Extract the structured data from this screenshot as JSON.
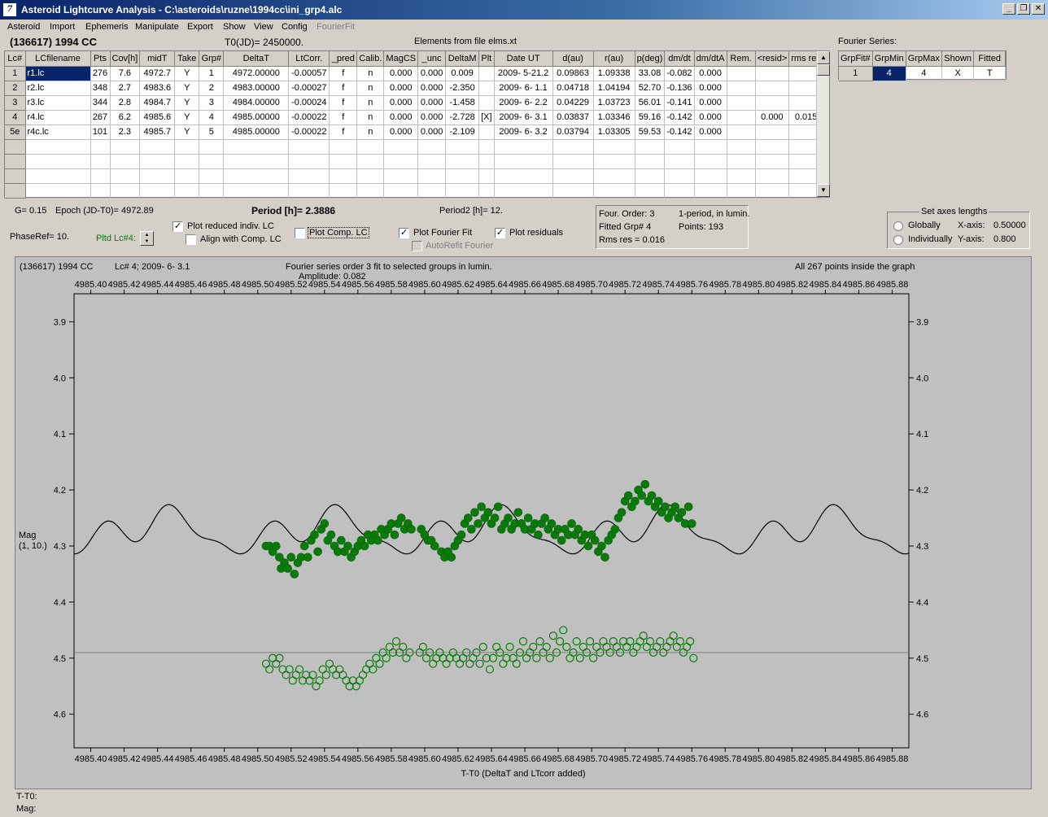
{
  "window": {
    "title": "Asteroid Lightcurve Analysis - C:\\asteroids\\ruzne\\1994cc\\ini_grp4.alc",
    "icon_name": "app-icon",
    "buttons": [
      "_",
      "❐",
      "✕"
    ]
  },
  "menu": [
    "Asteroid",
    "Import",
    "Ephemeris",
    "Manipulate",
    "Export",
    "Show",
    "View",
    "Config",
    "FourierFit"
  ],
  "header": {
    "asteroid": "(136617) 1994 CC",
    "t0": "T0(JD)= 2450000.",
    "elements": "Elements from file elms.xt",
    "fourier_label": "Fourier Series:"
  },
  "table": {
    "columns": [
      "Lc#",
      "LCfilename",
      "Pts",
      "Cov[h]",
      "midT",
      "Take",
      "Grp#",
      "DeltaT",
      "LtCorr.",
      "_pred",
      "Calib.",
      "MagCS",
      "_unc",
      "DeltaM",
      "Plt",
      "Date UT",
      "d(au)",
      "r(au)",
      "p(deg)",
      "dm/dt",
      "dm/dtA",
      "Rem.",
      "<resid>",
      "rms res"
    ],
    "rows": [
      [
        "1",
        "r1.lc",
        "276",
        "7.6",
        "4972.7",
        "Y",
        "1",
        "4972.00000",
        "-0.00057",
        "f",
        "n",
        "0.000",
        "0.000",
        "0.009",
        "",
        "2009- 5-21.2",
        "0.09863",
        "1.09338",
        "33.08",
        "-0.082",
        "0.000",
        "",
        "",
        ""
      ],
      [
        "2",
        "r2.lc",
        "348",
        "2.7",
        "4983.6",
        "Y",
        "2",
        "4983.00000",
        "-0.00027",
        "f",
        "n",
        "0.000",
        "0.000",
        "-2.350",
        "",
        "2009- 6- 1.1",
        "0.04718",
        "1.04194",
        "52.70",
        "-0.136",
        "0.000",
        "",
        "",
        ""
      ],
      [
        "3",
        "r3.lc",
        "344",
        "2.8",
        "4984.7",
        "Y",
        "3",
        "4984.00000",
        "-0.00024",
        "f",
        "n",
        "0.000",
        "0.000",
        "-1.458",
        "",
        "2009- 6- 2.2",
        "0.04229",
        "1.03723",
        "56.01",
        "-0.141",
        "0.000",
        "",
        "",
        ""
      ],
      [
        "4",
        "r4.lc",
        "267",
        "6.2",
        "4985.6",
        "Y",
        "4",
        "4985.00000",
        "-0.00022",
        "f",
        "n",
        "0.000",
        "0.000",
        "-2.728",
        "[X]",
        "2009- 6- 3.1",
        "0.03837",
        "1.03346",
        "59.16",
        "-0.142",
        "0.000",
        "",
        "0.000",
        "0.015"
      ],
      [
        "5e",
        "r4c.lc",
        "101",
        "2.3",
        "4985.7",
        "Y",
        "5",
        "4985.00000",
        "-0.00022",
        "f",
        "n",
        "0.000",
        "0.000",
        "-2.109",
        "",
        "2009- 6- 3.2",
        "0.03794",
        "1.03305",
        "59.53",
        "-0.142",
        "0.000",
        "",
        "",
        ""
      ]
    ],
    "empty_rows": 4
  },
  "fourier_table": {
    "columns": [
      "GrpFit#",
      "GrpMin",
      "GrpMax",
      "Shown",
      "Fitted"
    ],
    "row": [
      "1",
      "4",
      "4",
      "X",
      "T"
    ]
  },
  "controls": {
    "g": "G= 0.15",
    "epoch": "Epoch (JD-T0)= 4972.89",
    "period": "Period [h]= 2.3886",
    "period2": "Period2 [h]= 12.",
    "phaseref": "PhaseRef= 10.",
    "pltd": "Pltd Lc#4:",
    "plot_reduced": "Plot reduced indiv. LC",
    "align": "Align with Comp. LC",
    "plot_comp": "Plot Comp. LC",
    "plot_fourier": "Plot Fourier Fit",
    "plot_residuals": "Plot residuals",
    "autorefit": "AutoRefit Fourier",
    "info": {
      "order": "Four. Order:  3",
      "one_period": "1-period, in lumin.",
      "fitted": "Fitted Grp# 4",
      "points": "Points: 193",
      "rms": "Rms res     = 0.016"
    },
    "axes": {
      "title": "Set axes lengths",
      "globally": "Globally",
      "individually": "Individually",
      "x_label": "X-axis:",
      "x_value": "0.50000",
      "y_label": "Y-axis:",
      "y_value": "0.800"
    }
  },
  "plot": {
    "top_left": "(136617) 1994 CC",
    "lc_info": "Lc# 4; 2009- 6- 3.1",
    "fit_info": "Fourier series order 3 fit to selected groups in lumin.",
    "amplitude": "Amplitude: 0.082",
    "inside": "All 267 points inside the graph",
    "ylabel_1": "Mag",
    "ylabel_2": "(1, 10.)",
    "xlabel": "T-T0 (DeltaT and LTcorr added)"
  },
  "status": {
    "t_t0": "T-T0:",
    "mag": "Mag:"
  },
  "chart_data": {
    "type": "scatter",
    "xlim": [
      4985.39,
      4985.89
    ],
    "ylim": [
      4.66,
      3.85
    ],
    "x_ticks": [
      4985.4,
      4985.42,
      4985.44,
      4985.46,
      4985.48,
      4985.5,
      4985.52,
      4985.54,
      4985.56,
      4985.58,
      4985.6,
      4985.62,
      4985.64,
      4985.66,
      4985.68,
      4985.7,
      4985.72,
      4985.74,
      4985.76,
      4985.78,
      4985.8,
      4985.82,
      4985.84,
      4985.86,
      4985.88
    ],
    "y_ticks": [
      3.9,
      4.0,
      4.1,
      4.2,
      4.3,
      4.4,
      4.5,
      4.6
    ],
    "residual_zero": 4.49,
    "fourier_period_days": 0.0995,
    "fourier_mean": 4.275,
    "fourier_coeffs": [
      [
        0.025,
        0.002
      ],
      [
        0.004,
        -0.018
      ],
      [
        0.01,
        0.012
      ]
    ],
    "data_points": [
      [
        4985.505,
        4.3
      ],
      [
        4985.507,
        4.3
      ],
      [
        4985.509,
        4.31
      ],
      [
        4985.511,
        4.3
      ],
      [
        4985.513,
        4.32
      ],
      [
        4985.514,
        4.34
      ],
      [
        4985.516,
        4.33
      ],
      [
        4985.518,
        4.34
      ],
      [
        4985.52,
        4.32
      ],
      [
        4985.522,
        4.35
      ],
      [
        4985.524,
        4.33
      ],
      [
        4985.526,
        4.32
      ],
      [
        4985.528,
        4.3
      ],
      [
        4985.53,
        4.32
      ],
      [
        4985.532,
        4.29
      ],
      [
        4985.534,
        4.28
      ],
      [
        4985.536,
        4.31
      ],
      [
        4985.538,
        4.27
      ],
      [
        4985.54,
        4.26
      ],
      [
        4985.542,
        4.29
      ],
      [
        4985.544,
        4.28
      ],
      [
        4985.546,
        4.3
      ],
      [
        4985.548,
        4.31
      ],
      [
        4985.55,
        4.29
      ],
      [
        4985.552,
        4.31
      ],
      [
        4985.554,
        4.3
      ],
      [
        4985.556,
        4.32
      ],
      [
        4985.558,
        4.31
      ],
      [
        4985.56,
        4.3
      ],
      [
        4985.562,
        4.29
      ],
      [
        4985.564,
        4.3
      ],
      [
        4985.566,
        4.28
      ],
      [
        4985.568,
        4.29
      ],
      [
        4985.57,
        4.28
      ],
      [
        4985.572,
        4.29
      ],
      [
        4985.574,
        4.27
      ],
      [
        4985.576,
        4.28
      ],
      [
        4985.578,
        4.27
      ],
      [
        4985.58,
        4.26
      ],
      [
        4985.582,
        4.28
      ],
      [
        4985.584,
        4.26
      ],
      [
        4985.586,
        4.25
      ],
      [
        4985.588,
        4.27
      ],
      [
        4985.59,
        4.26
      ],
      [
        4985.592,
        4.27
      ],
      [
        4985.598,
        4.27
      ],
      [
        4985.6,
        4.28
      ],
      [
        4985.602,
        4.29
      ],
      [
        4985.604,
        4.29
      ],
      [
        4985.606,
        4.3
      ],
      [
        4985.61,
        4.31
      ],
      [
        4985.612,
        4.32
      ],
      [
        4985.614,
        4.31
      ],
      [
        4985.616,
        4.32
      ],
      [
        4985.618,
        4.3
      ],
      [
        4985.62,
        4.29
      ],
      [
        4985.622,
        4.28
      ],
      [
        4985.624,
        4.26
      ],
      [
        4985.626,
        4.25
      ],
      [
        4985.628,
        4.27
      ],
      [
        4985.63,
        4.24
      ],
      [
        4985.632,
        4.26
      ],
      [
        4985.634,
        4.23
      ],
      [
        4985.636,
        4.25
      ],
      [
        4985.638,
        4.24
      ],
      [
        4985.64,
        4.26
      ],
      [
        4985.642,
        4.25
      ],
      [
        4985.644,
        4.23
      ],
      [
        4985.646,
        4.27
      ],
      [
        4985.648,
        4.26
      ],
      [
        4985.65,
        4.25
      ],
      [
        4985.652,
        4.27
      ],
      [
        4985.654,
        4.26
      ],
      [
        4985.656,
        4.24
      ],
      [
        4985.658,
        4.26
      ],
      [
        4985.66,
        4.27
      ],
      [
        4985.662,
        4.25
      ],
      [
        4985.664,
        4.27
      ],
      [
        4985.666,
        4.26
      ],
      [
        4985.668,
        4.28
      ],
      [
        4985.67,
        4.26
      ],
      [
        4985.672,
        4.25
      ],
      [
        4985.674,
        4.27
      ],
      [
        4985.676,
        4.26
      ],
      [
        4985.678,
        4.28
      ],
      [
        4985.68,
        4.27
      ],
      [
        4985.682,
        4.29
      ],
      [
        4985.684,
        4.27
      ],
      [
        4985.686,
        4.28
      ],
      [
        4985.688,
        4.26
      ],
      [
        4985.69,
        4.28
      ],
      [
        4985.692,
        4.27
      ],
      [
        4985.694,
        4.29
      ],
      [
        4985.696,
        4.28
      ],
      [
        4985.698,
        4.3
      ],
      [
        4985.7,
        4.28
      ],
      [
        4985.702,
        4.29
      ],
      [
        4985.704,
        4.31
      ],
      [
        4985.706,
        4.3
      ],
      [
        4985.708,
        4.32
      ],
      [
        4985.71,
        4.29
      ],
      [
        4985.712,
        4.28
      ],
      [
        4985.714,
        4.27
      ],
      [
        4985.716,
        4.25
      ],
      [
        4985.718,
        4.24
      ],
      [
        4985.72,
        4.22
      ],
      [
        4985.722,
        4.21
      ],
      [
        4985.724,
        4.23
      ],
      [
        4985.726,
        4.22
      ],
      [
        4985.728,
        4.2
      ],
      [
        4985.73,
        4.21
      ],
      [
        4985.732,
        4.19
      ],
      [
        4985.734,
        4.22
      ],
      [
        4985.736,
        4.21
      ],
      [
        4985.738,
        4.23
      ],
      [
        4985.74,
        4.22
      ],
      [
        4985.742,
        4.24
      ],
      [
        4985.744,
        4.23
      ],
      [
        4985.746,
        4.25
      ],
      [
        4985.748,
        4.24
      ],
      [
        4985.75,
        4.23
      ],
      [
        4985.752,
        4.25
      ],
      [
        4985.754,
        4.24
      ],
      [
        4985.756,
        4.26
      ],
      [
        4985.758,
        4.23
      ],
      [
        4985.76,
        4.26
      ]
    ],
    "residual_points": [
      [
        4985.505,
        4.51
      ],
      [
        4985.507,
        4.52
      ],
      [
        4985.509,
        4.5
      ],
      [
        4985.511,
        4.51
      ],
      [
        4985.513,
        4.5
      ],
      [
        4985.515,
        4.52
      ],
      [
        4985.517,
        4.53
      ],
      [
        4985.519,
        4.52
      ],
      [
        4985.521,
        4.54
      ],
      [
        4985.523,
        4.53
      ],
      [
        4985.525,
        4.52
      ],
      [
        4985.527,
        4.54
      ],
      [
        4985.529,
        4.53
      ],
      [
        4985.531,
        4.54
      ],
      [
        4985.533,
        4.53
      ],
      [
        4985.535,
        4.55
      ],
      [
        4985.537,
        4.54
      ],
      [
        4985.539,
        4.52
      ],
      [
        4985.541,
        4.53
      ],
      [
        4985.543,
        4.51
      ],
      [
        4985.545,
        4.52
      ],
      [
        4985.547,
        4.53
      ],
      [
        4985.549,
        4.52
      ],
      [
        4985.551,
        4.53
      ],
      [
        4985.553,
        4.54
      ],
      [
        4985.555,
        4.55
      ],
      [
        4985.557,
        4.54
      ],
      [
        4985.559,
        4.55
      ],
      [
        4985.561,
        4.54
      ],
      [
        4985.563,
        4.53
      ],
      [
        4985.565,
        4.52
      ],
      [
        4985.567,
        4.51
      ],
      [
        4985.569,
        4.52
      ],
      [
        4985.571,
        4.5
      ],
      [
        4985.573,
        4.51
      ],
      [
        4985.575,
        4.49
      ],
      [
        4985.577,
        4.5
      ],
      [
        4985.579,
        4.48
      ],
      [
        4985.581,
        4.49
      ],
      [
        4985.583,
        4.47
      ],
      [
        4985.585,
        4.49
      ],
      [
        4985.587,
        4.48
      ],
      [
        4985.589,
        4.5
      ],
      [
        4985.591,
        4.49
      ],
      [
        4985.597,
        4.49
      ],
      [
        4985.599,
        4.48
      ],
      [
        4985.601,
        4.5
      ],
      [
        4985.603,
        4.49
      ],
      [
        4985.605,
        4.51
      ],
      [
        4985.607,
        4.5
      ],
      [
        4985.609,
        4.49
      ],
      [
        4985.611,
        4.5
      ],
      [
        4985.613,
        4.51
      ],
      [
        4985.615,
        4.5
      ],
      [
        4985.617,
        4.49
      ],
      [
        4985.619,
        4.5
      ],
      [
        4985.621,
        4.51
      ],
      [
        4985.623,
        4.5
      ],
      [
        4985.625,
        4.49
      ],
      [
        4985.627,
        4.51
      ],
      [
        4985.629,
        4.5
      ],
      [
        4985.631,
        4.49
      ],
      [
        4985.633,
        4.51
      ],
      [
        4985.635,
        4.48
      ],
      [
        4985.637,
        4.5
      ],
      [
        4985.639,
        4.52
      ],
      [
        4985.641,
        4.5
      ],
      [
        4985.643,
        4.48
      ],
      [
        4985.645,
        4.49
      ],
      [
        4985.647,
        4.51
      ],
      [
        4985.649,
        4.5
      ],
      [
        4985.651,
        4.48
      ],
      [
        4985.653,
        4.5
      ],
      [
        4985.655,
        4.51
      ],
      [
        4985.657,
        4.49
      ],
      [
        4985.659,
        4.47
      ],
      [
        4985.661,
        4.5
      ],
      [
        4985.663,
        4.49
      ],
      [
        4985.665,
        4.48
      ],
      [
        4985.667,
        4.5
      ],
      [
        4985.669,
        4.47
      ],
      [
        4985.671,
        4.49
      ],
      [
        4985.673,
        4.48
      ],
      [
        4985.675,
        4.5
      ],
      [
        4985.677,
        4.46
      ],
      [
        4985.679,
        4.49
      ],
      [
        4985.681,
        4.47
      ],
      [
        4985.683,
        4.45
      ],
      [
        4985.685,
        4.48
      ],
      [
        4985.687,
        4.5
      ],
      [
        4985.689,
        4.49
      ],
      [
        4985.691,
        4.47
      ],
      [
        4985.693,
        4.5
      ],
      [
        4985.695,
        4.48
      ],
      [
        4985.697,
        4.49
      ],
      [
        4985.699,
        4.47
      ],
      [
        4985.701,
        4.5
      ],
      [
        4985.703,
        4.48
      ],
      [
        4985.705,
        4.49
      ],
      [
        4985.707,
        4.47
      ],
      [
        4985.709,
        4.48
      ],
      [
        4985.711,
        4.49
      ],
      [
        4985.713,
        4.47
      ],
      [
        4985.715,
        4.48
      ],
      [
        4985.717,
        4.49
      ],
      [
        4985.719,
        4.47
      ],
      [
        4985.721,
        4.48
      ],
      [
        4985.723,
        4.47
      ],
      [
        4985.725,
        4.49
      ],
      [
        4985.727,
        4.48
      ],
      [
        4985.729,
        4.47
      ],
      [
        4985.731,
        4.46
      ],
      [
        4985.733,
        4.48
      ],
      [
        4985.735,
        4.47
      ],
      [
        4985.737,
        4.49
      ],
      [
        4985.739,
        4.48
      ],
      [
        4985.741,
        4.47
      ],
      [
        4985.743,
        4.49
      ],
      [
        4985.745,
        4.48
      ],
      [
        4985.747,
        4.47
      ],
      [
        4985.749,
        4.46
      ],
      [
        4985.751,
        4.48
      ],
      [
        4985.753,
        4.47
      ],
      [
        4985.755,
        4.49
      ],
      [
        4985.757,
        4.48
      ],
      [
        4985.759,
        4.47
      ],
      [
        4985.761,
        4.5
      ]
    ],
    "colors": {
      "points": "#0a7a0a",
      "curve": "#000000",
      "background": "#c0c0c0",
      "zero_line": "#808080"
    },
    "grid": false
  }
}
